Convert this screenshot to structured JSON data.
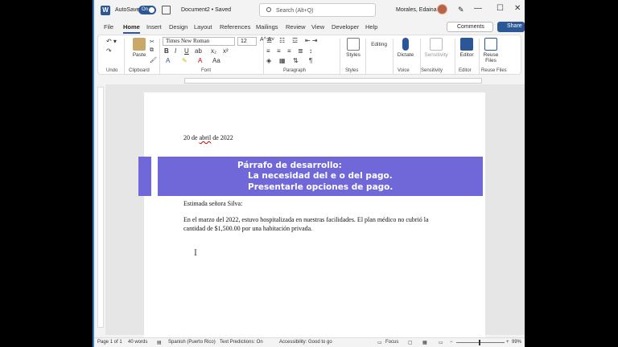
{
  "titlebar": {
    "logo": "W",
    "autosave_label": "AutoSave",
    "autosave_state": "On",
    "doc_name": "Document2 • Saved",
    "search_placeholder": "Search (Alt+Q)",
    "user_name": "Morales, Edaina"
  },
  "menu": {
    "tabs": [
      "File",
      "Home",
      "Insert",
      "Design",
      "Layout",
      "References",
      "Mailings",
      "Review",
      "View",
      "Developer",
      "Help"
    ],
    "active_tab": "Home",
    "comments_label": "Comments",
    "share_label": "Share"
  },
  "ribbon": {
    "paste_label": "Paste",
    "font_name": "Times New Roman",
    "font_size": "12",
    "styles_label": "Styles",
    "editing_label": "Editing",
    "dictate_label": "Dictate",
    "sensitivity_label": "Sensitivity",
    "editor_label": "Editor",
    "reuse_label": "Reuse Files",
    "groups": {
      "undo": "Undo",
      "clipboard": "Clipboard",
      "font": "Font",
      "paragraph": "Paragraph",
      "styles": "Styles",
      "voice": "Voice",
      "sensitivity": "Sensitivity",
      "editor": "Editor",
      "reuse": "Reuse Files"
    }
  },
  "document": {
    "date_prefix": "20 de ",
    "date_underlined": "abril",
    "date_suffix": " de 2022",
    "salutation": "Estimada señora Silva:",
    "body_line1": "En el marzo del 2022, estuvo hospitalizada en nuestras facilidades.  El plan médico no cubrió la",
    "body_line2": "cantidad de $1,500.00 por una habitación privada."
  },
  "banner": {
    "line1": "Párrafo de desarrollo:",
    "line2": "La necesidad del e     o del pago.",
    "line3": "Presentarle opciones de pago.",
    "color": "#7068d8"
  },
  "status": {
    "page": "Page 1 of 1",
    "words": "40 words",
    "language": "Spanish (Puerto Rico)",
    "predictions": "Text Predictions: On",
    "accessibility": "Accessibility: Good to go",
    "focus": "Focus",
    "zoom": "99%"
  }
}
